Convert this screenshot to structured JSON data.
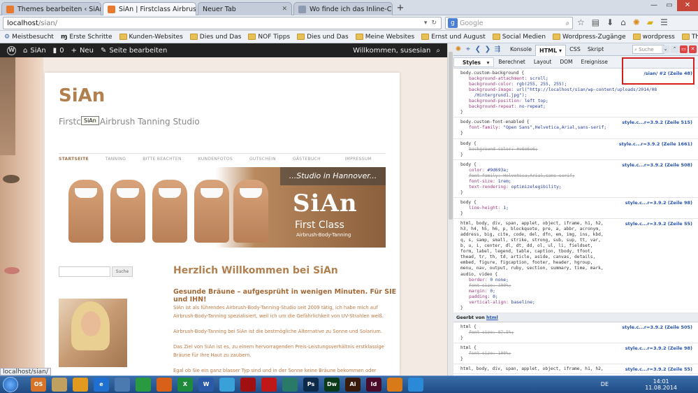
{
  "browser": {
    "tabs": [
      {
        "label": "Themes bearbeiten ‹ SiAn ...",
        "active": false
      },
      {
        "label": "SiAn | Firstclass Airbrush Ta...",
        "active": true
      },
      {
        "label": "Neuer Tab",
        "active": false
      },
      {
        "label": "Wo finde ich das Inline-CS...",
        "active": false
      }
    ],
    "new_tab": "+",
    "url_host": "localhost",
    "url_path": "/sian/",
    "search_placeholder": "Google",
    "bookmarks": [
      "Meistbesucht",
      "Erste Schritte",
      "Kunden-Websites",
      "Dies und Das",
      "NOF Tipps",
      "Dies und Das",
      "Meine Websites",
      "Ernst und August",
      "Social Medien",
      "Wordpress-Zugänge",
      "wordpress",
      "Themes"
    ]
  },
  "wp_bar": {
    "site": "SiAn",
    "comments": "0",
    "new": "Neu",
    "edit": "Seite bearbeiten",
    "welcome": "Willkommen, susesian"
  },
  "site": {
    "title": "SiAn",
    "description": "Firstclass Airbrush Tanning Studio",
    "tooltip": "SiAn",
    "menu": [
      "STARTSEITE",
      "TANNING",
      "BITTE BEACHTEN",
      "KUNDENFOTOS",
      "GUTSCHEIN",
      "GÄSTEBUCH"
    ],
    "menu_last": "IMPRESSUM",
    "banner": {
      "studio": "...Studio in Hannover...",
      "logo": "SiAn",
      "firstclass": "First Class",
      "sub": "Airbrush-Body-Tanning"
    },
    "search_button": "Suche",
    "heading": "Herzlich Willkommen bei SiAn",
    "subheading": "Gesunde Bräune – aufgesprüht in wenigen Minuten. Für SIE und IHN!",
    "paragraphs": [
      "SiAn ist als führendes Airbrush-Body-Tanning-Studio seit 2009 tätig, ich habe mich auf Airbrush-Body-Tanning spezialisiert, weil ich um die Gefährlichkeit von UV-Strahlen weiß.",
      "Airbrush-Body-Tanning bei SiAn ist die bestmögliche Alternative zu Sonne und Solarium.",
      "Das Ziel von SiAn ist es, zu einem hervorragenden Preis-Leistungsverhältnis erstklassige Bräune für Ihre Haut zu zaubern.",
      "Egal ob Sie ein ganz blasser Typ sind und in der Sonne keine Bräune bekommen oder bereits w..."
    ]
  },
  "status_url": "localhost/sian/",
  "firebug": {
    "tabs": [
      "Konsole",
      "HTML",
      "CSS",
      "Skript"
    ],
    "active_tab": "HTML",
    "search_placeholder": "Suche",
    "subtabs": [
      "Styles",
      "Berechnet",
      "Layout",
      "DOM",
      "Ereignisse"
    ],
    "active_subtab": "Styles",
    "inherited_label": "Geerbt von",
    "inherited_el": "html",
    "rules": [
      {
        "sel": "body.custom-background {",
        "src": "/sian/ #2 (Zeile 48)",
        "decls": [
          [
            "background-attachment",
            "scroll;",
            false
          ],
          [
            "background-color",
            "rgb(255, 255, 255);",
            false
          ],
          [
            "background-image",
            "url(\"http://localhost/sian/wp-content/uploads/2014/08",
            "",
            false
          ],
          [
            "",
            "/Hintergrund1.jpg\");",
            false
          ],
          [
            "background-position",
            "left top;",
            false
          ],
          [
            "background-repeat",
            "no-repeat;",
            false
          ]
        ]
      },
      {
        "sel": "body.custom-font-enabled {",
        "src": "style.c...r=3.9.2 (Zeile 515)",
        "decls": [
          [
            "font-family",
            "\"Open Sans\",Helvetica,Arial,sans-serif;",
            false
          ]
        ]
      },
      {
        "sel": "body {",
        "src": "style.c...r=3.9.2 (Zeile 1661)",
        "decls": [
          [
            "background-color",
            "#e6e6e6;",
            true
          ]
        ]
      },
      {
        "sel": "body {",
        "src": "style.c...r=3.9.2 (Zeile 508)",
        "decls": [
          [
            "color",
            "#9d693a;",
            false
          ],
          [
            "font-family",
            "Helvetica,Arial,sans-serif;",
            true
          ],
          [
            "font-size",
            "1rem;",
            false
          ],
          [
            "text-rendering",
            "optimizelegibility;",
            false
          ]
        ]
      },
      {
        "sel": "body {",
        "src": "style.c...r=3.9.2 (Zeile 98)",
        "decls": [
          [
            "line-height",
            "1;",
            false
          ]
        ]
      },
      {
        "sel": "html, body, div, span, applet, object, iframe, h1, h2,",
        "src": "style.c...r=3.9.2 (Zeile 55)",
        "extra": [
          "h3, h4, h5, h6, p, blockquote, pre, a, abbr, acronym,",
          "address, big, cite, code, del, dfn, em, img, ins, kbd,",
          "q, s, samp, small, strike, strong, sub, sup, tt, var,",
          "b, u, i, center, dl, dt, dd, ol, ul, li, fieldset,",
          "form, label, legend, table, caption, tbody, tfoot,",
          "thead, tr, th, td, article, aside, canvas, details,",
          "embed, figure, figcaption, footer, header, hgroup,",
          "menu, nav, output, ruby, section, summary, time, mark,",
          "audio, video {"
        ],
        "decls": [
          [
            "border",
            "0 none;",
            false
          ],
          [
            "font-size",
            "100%;",
            true
          ],
          [
            "margin",
            "0;",
            false
          ],
          [
            "padding",
            "0;",
            false
          ],
          [
            "vertical-align",
            "baseline;",
            false
          ]
        ]
      }
    ],
    "inh_rules": [
      {
        "sel": "html {",
        "src": "style.c...r=3.9.2 (Zeile 505)",
        "decls": [
          [
            "font-size",
            "87.5%;",
            true
          ]
        ]
      },
      {
        "sel": "html {",
        "src": "style.c...r=3.9.2 (Zeile 98)",
        "decls": [
          [
            "font-size",
            "100%;",
            true
          ]
        ]
      },
      {
        "sel": "html, body, div, span, applet, object, iframe, h1, h2,",
        "src": "style.c...r=3.9.2 (Zeile 55)",
        "decls": []
      }
    ]
  },
  "taskbar": {
    "lang": "DE",
    "time": "14:01",
    "date": "11.08.2014",
    "apps": [
      "OS",
      "",
      "",
      "e",
      "",
      "",
      "",
      "X",
      "W",
      "",
      "",
      "",
      "",
      "Ps",
      "Dw",
      "Ai",
      "Id",
      "",
      ""
    ]
  }
}
